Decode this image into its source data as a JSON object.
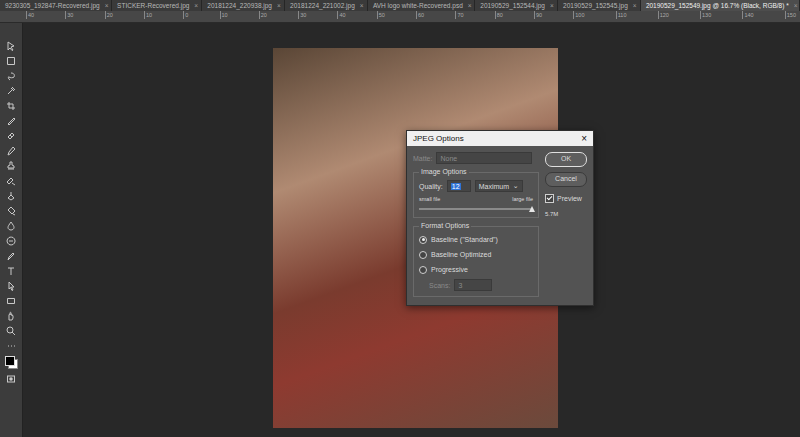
{
  "tabs": [
    {
      "label": "9230305_192847-Recovered.jpg",
      "selected": false
    },
    {
      "label": "STICKER-Recovered.jpg",
      "selected": false
    },
    {
      "label": "20181224_220938.jpg",
      "selected": false
    },
    {
      "label": "20181224_221002.jpg",
      "selected": false
    },
    {
      "label": "AVH logo white-Recovered.psd",
      "selected": false
    },
    {
      "label": "20190529_152544.jpg",
      "selected": false
    },
    {
      "label": "20190529_152545.jpg",
      "selected": false
    },
    {
      "label": "20190529_152549.jpg @ 16.7% (Black, RGB/8) *",
      "selected": true
    }
  ],
  "tabClose": "×",
  "ruler": {
    "ticks": [
      "40",
      "30",
      "20",
      "10",
      "0",
      "10",
      "20",
      "30",
      "40",
      "50",
      "60",
      "70",
      "80",
      "90",
      "100",
      "110",
      "120",
      "130",
      "140",
      "150"
    ]
  },
  "dialog": {
    "title": "JPEG Options",
    "close": "×",
    "matte": {
      "label": "Matte:",
      "value": "None",
      "disabled": true
    },
    "imageOptions": {
      "legend": "Image Options",
      "qualityLabel": "Quality:",
      "quality": "12",
      "qualityHighlighted": true,
      "preset": "Maximum",
      "presetArrow": "⌄",
      "smallLabel": "small file",
      "largeLabel": "large file",
      "level": 1
    },
    "formatOptions": {
      "legend": "Format Options",
      "options": [
        {
          "label": "Baseline (\"Standard\")",
          "selected": true
        },
        {
          "label": "Baseline Optimized",
          "selected": false
        },
        {
          "label": "Progressive",
          "selected": false
        }
      ],
      "scans": {
        "label": "Scans:",
        "value": "3",
        "disabled": true
      }
    },
    "buttons": [
      {
        "label": "OK",
        "default": true
      },
      {
        "label": "Cancel",
        "default": false
      }
    ],
    "preview": {
      "label": "Preview",
      "checked": true
    },
    "size": "5.7M"
  }
}
